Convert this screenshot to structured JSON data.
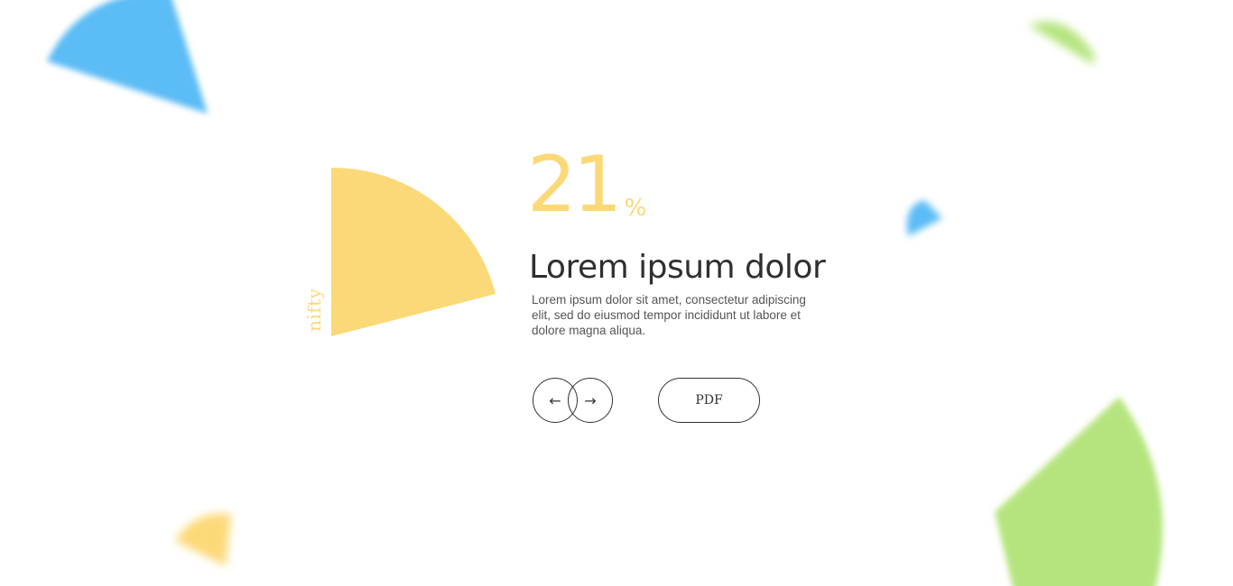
{
  "slide": {
    "label": "nifty",
    "stat_value": "21",
    "stat_unit": "%",
    "headline": "Lorem ipsum dolor",
    "body": "Lorem ipsum dolor sit amet, consectetur adipiscing elit, sed do eiusmod tempor incididunt ut labore et dolore magna aliqua."
  },
  "navigation": {
    "prev_icon": "arrow-left-icon",
    "next_icon": "arrow-right-icon",
    "prev_glyph": "←",
    "next_glyph": "→",
    "pdf_label": "PDF"
  },
  "colors": {
    "accent_yellow": "#fcd978",
    "accent_blue": "#5bbcf5",
    "accent_green": "#b5e47e",
    "text_dark": "#2f2f2f",
    "text_body": "#555555"
  }
}
